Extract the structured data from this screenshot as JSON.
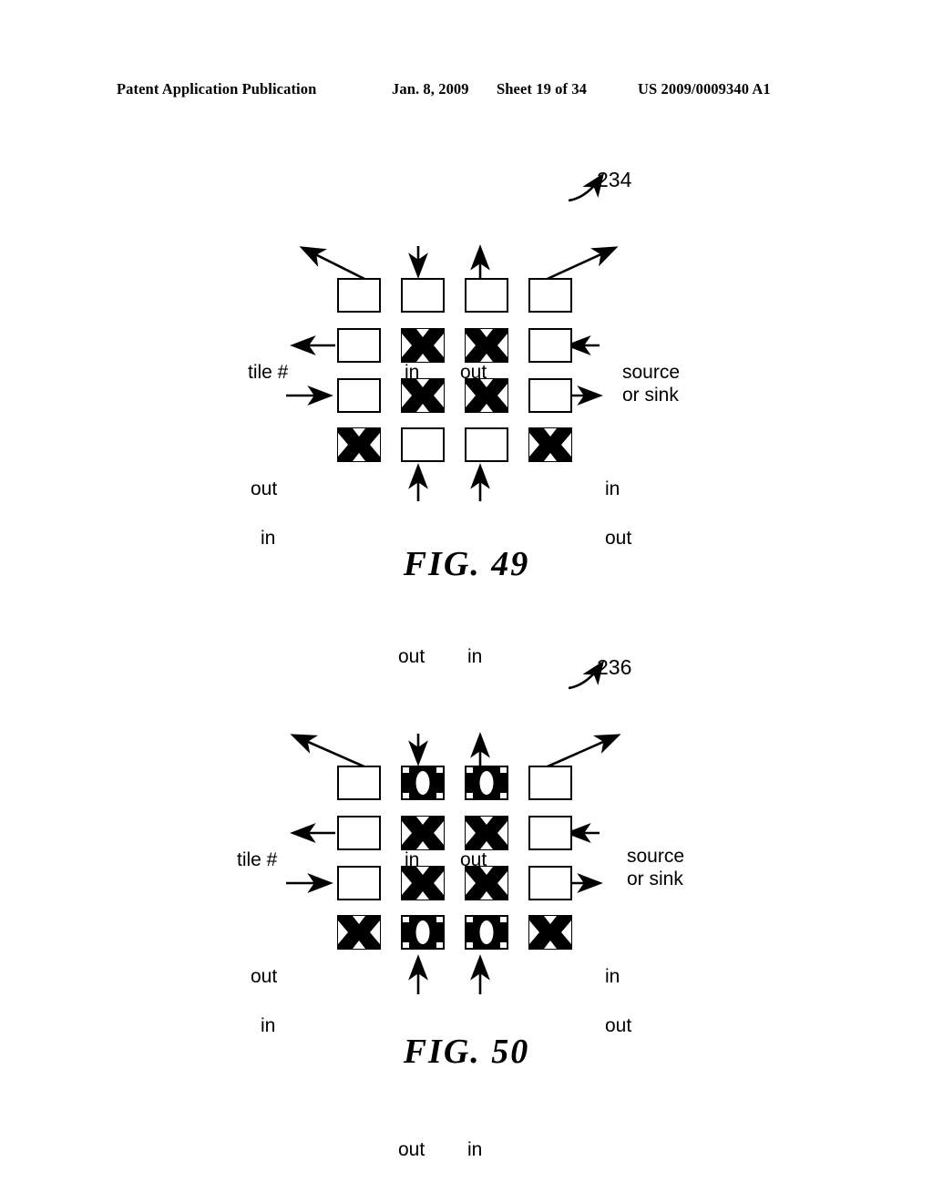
{
  "header": {
    "publication": "Patent Application Publication",
    "date": "Jan. 8, 2009",
    "sheet": "Sheet 19 of 34",
    "pub_number": "US 2009/0009340 A1"
  },
  "colors": {
    "ink": "#000000",
    "paper": "#ffffff"
  },
  "figures": [
    {
      "id": "fig-49",
      "caption": "FIG. 49",
      "reference_numeral": "234",
      "grid": {
        "rows": 4,
        "cols": 4,
        "cells": [
          [
            "empty",
            "empty",
            "empty",
            "empty"
          ],
          [
            "empty",
            "x",
            "x",
            "empty"
          ],
          [
            "empty",
            "x",
            "x",
            "empty"
          ],
          [
            "x",
            "empty",
            "empty",
            "x"
          ]
        ]
      },
      "labels": {
        "tile_number": "tile #",
        "in_top": "in",
        "out_top": "out",
        "source_or_sink": "source\nor sink",
        "out_left": "out",
        "in_left": "in",
        "in_right": "in",
        "out_right": "out",
        "out_bottom": "out",
        "in_bottom": "in"
      }
    },
    {
      "id": "fig-50",
      "caption": "FIG. 50",
      "reference_numeral": "236",
      "grid": {
        "rows": 4,
        "cols": 4,
        "cells": [
          [
            "empty",
            "o",
            "o",
            "empty"
          ],
          [
            "empty",
            "x",
            "x",
            "empty"
          ],
          [
            "empty",
            "x",
            "x",
            "empty"
          ],
          [
            "x",
            "o",
            "o",
            "x"
          ]
        ]
      },
      "labels": {
        "tile_number": "tile #",
        "in_top": "in",
        "out_top": "out",
        "source_or_sink": "source\nor sink",
        "out_left": "out",
        "in_left": "in",
        "in_right": "in",
        "out_right": "out",
        "out_bottom": "out",
        "in_bottom": "in"
      }
    }
  ]
}
